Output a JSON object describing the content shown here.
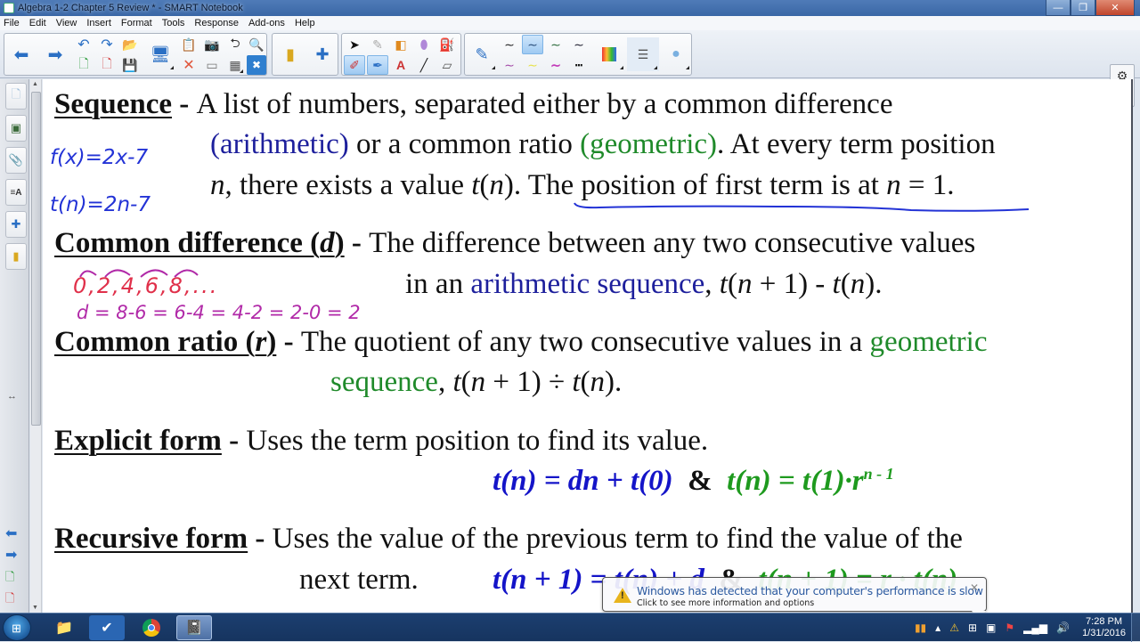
{
  "window": {
    "title": "Algebra 1-2 Chapter 5 Review * - SMART Notebook",
    "minimize": "—",
    "restore": "❐",
    "close": "✕"
  },
  "menu": [
    "File",
    "Edit",
    "View",
    "Insert",
    "Format",
    "Tools",
    "Response",
    "Add-ons",
    "Help"
  ],
  "toolbar": {
    "icons": {
      "back": "back-arrow-icon",
      "forward": "forward-arrow-icon",
      "undo": "undo-icon",
      "redo": "redo-icon",
      "open": "open-file-icon",
      "add_page": "add-page-icon",
      "delete_page": "delete-page-icon",
      "save": "save-icon",
      "display": "display-icon",
      "paste": "paste-icon",
      "screen_capture": "screen-capture-icon",
      "delete": "delete-icon",
      "screen_shade": "screen-shade-icon",
      "table": "table-icon",
      "full_screen": "full-screen-icon",
      "undo_redo_toggle": "page-action-icon",
      "gallery_note": "note-icon",
      "addons": "puzzle-icon",
      "select": "select-arrow-icon",
      "pen": "pen-icon",
      "shapes": "shapes-icon",
      "eraser": "eraser-icon",
      "fill": "fill-icon",
      "pens": "pens-icon",
      "creative_pen": "creative-pen-icon",
      "text": "text-icon",
      "line": "line-icon",
      "magic_eraser": "eraser-block-icon",
      "color_palette": "color-palette-icon",
      "properties": "properties-icon",
      "transparency": "transparency-icon"
    },
    "line_styles": [
      "black-thin",
      "blue-selected",
      "green-thin",
      "navy-thin",
      "purple-thin",
      "yellow-highlight",
      "magenta-thick",
      "black-dashed"
    ],
    "settings_icon": "gear-icon",
    "move_icon": "move-toolbar-icon"
  },
  "sidebar": {
    "tabs": [
      "page-sorter-icon",
      "gallery-icon",
      "attachments-icon",
      "properties-icon",
      "addons-icon",
      "response-icon"
    ],
    "bottom": [
      "prev-page-icon",
      "next-page-icon",
      "add-page-icon",
      "delete-page-icon"
    ],
    "resize_glyph": "↔"
  },
  "content": {
    "sequence": {
      "term": "Sequence",
      "dash": " - ",
      "line1": "A list of numbers, separated either by a common difference",
      "line2_a": "(arithmetic)",
      "line2_b": " or a common ratio ",
      "line2_c": "(geometric)",
      "line2_d": ". At every term position",
      "line3_a": "n",
      "line3_b": ", there exists a value ",
      "line3_c": "t",
      "line3_d": "(",
      "line3_e": "n",
      "line3_f": "). The position of first term is at ",
      "line3_g": "n",
      "line3_h": " = 1."
    },
    "common_difference": {
      "term_a": "Common difference (",
      "term_var": "d",
      "term_b": ")",
      "dash": " - ",
      "line1": "The difference between any two consecutive values",
      "line2_a": "in an ",
      "line2_b": "arithmetic sequence",
      "line2_c": ", ",
      "line2_expr_a": "t",
      "line2_expr_b": "(",
      "line2_expr_c": "n",
      "line2_expr_d": " + 1) - ",
      "line2_expr_e": "t",
      "line2_expr_f": "(",
      "line2_expr_g": "n",
      "line2_expr_h": ")."
    },
    "common_ratio": {
      "term_a": "Common ratio (",
      "term_var": "r",
      "term_b": ")",
      "dash": " - ",
      "line1_a": "The quotient of any two consecutive values in a ",
      "line1_b": "geometric",
      "line2_a": "sequence",
      "line2_b": ", ",
      "expr_t1": "t",
      "expr_a": "(",
      "expr_n1": "n",
      "expr_b": " + 1) ÷ ",
      "expr_t2": "t",
      "expr_c": "(",
      "expr_n2": "n",
      "expr_d": ")."
    },
    "explicit": {
      "term": "Explicit form",
      "dash": " - ",
      "line1": "Uses the term position to find its value.",
      "formula_arith": "t(n) = dn + t(0)",
      "amp": "&",
      "formula_geo": "t(n) = t(1)·r",
      "formula_geo_exp": "n - 1"
    },
    "recursive": {
      "term": "Recursive form",
      "dash": " - ",
      "line1": "Uses the value of the previous term to find the value of the",
      "line2": "next term.",
      "formula_arith": "t(n + 1) = t(n) + d",
      "amp": "&",
      "formula_geo": "t(n + 1) = r · t(n)"
    },
    "ink": {
      "fx": "f(x)=2x-7",
      "tn": "t(n)=2n-7",
      "seq": "0,2,4,6,8,...",
      "diff": "d = 8-6 = 6-4 = 4-2 = 2-0  = 2"
    }
  },
  "colors": {
    "arithmetic": "#1d1f9c",
    "geometric": "#1f8a2a",
    "formula_blue": "#1414c8",
    "formula_green": "#1e9a1e",
    "ink_blue": "#2333d6",
    "ink_red": "#e0304a",
    "ink_purple": "#b12aa8"
  },
  "notification": {
    "title": "Windows has detected that your computer's performance is slow",
    "subtitle": "Click to see more information and options",
    "icon": "warning-icon"
  },
  "taskbar": {
    "apps": [
      "windows-explorer-icon",
      "task-check-icon",
      "chrome-icon",
      "smart-notebook-icon"
    ],
    "tray": [
      "smart-board-tools-icon",
      "show-hidden-icons",
      "action-center-warning-icon",
      "windows-icon",
      "network-device-icon",
      "flag-icon",
      "signal-icon",
      "volume-icon"
    ],
    "time": "7:28 PM",
    "date": "1/31/2016"
  }
}
